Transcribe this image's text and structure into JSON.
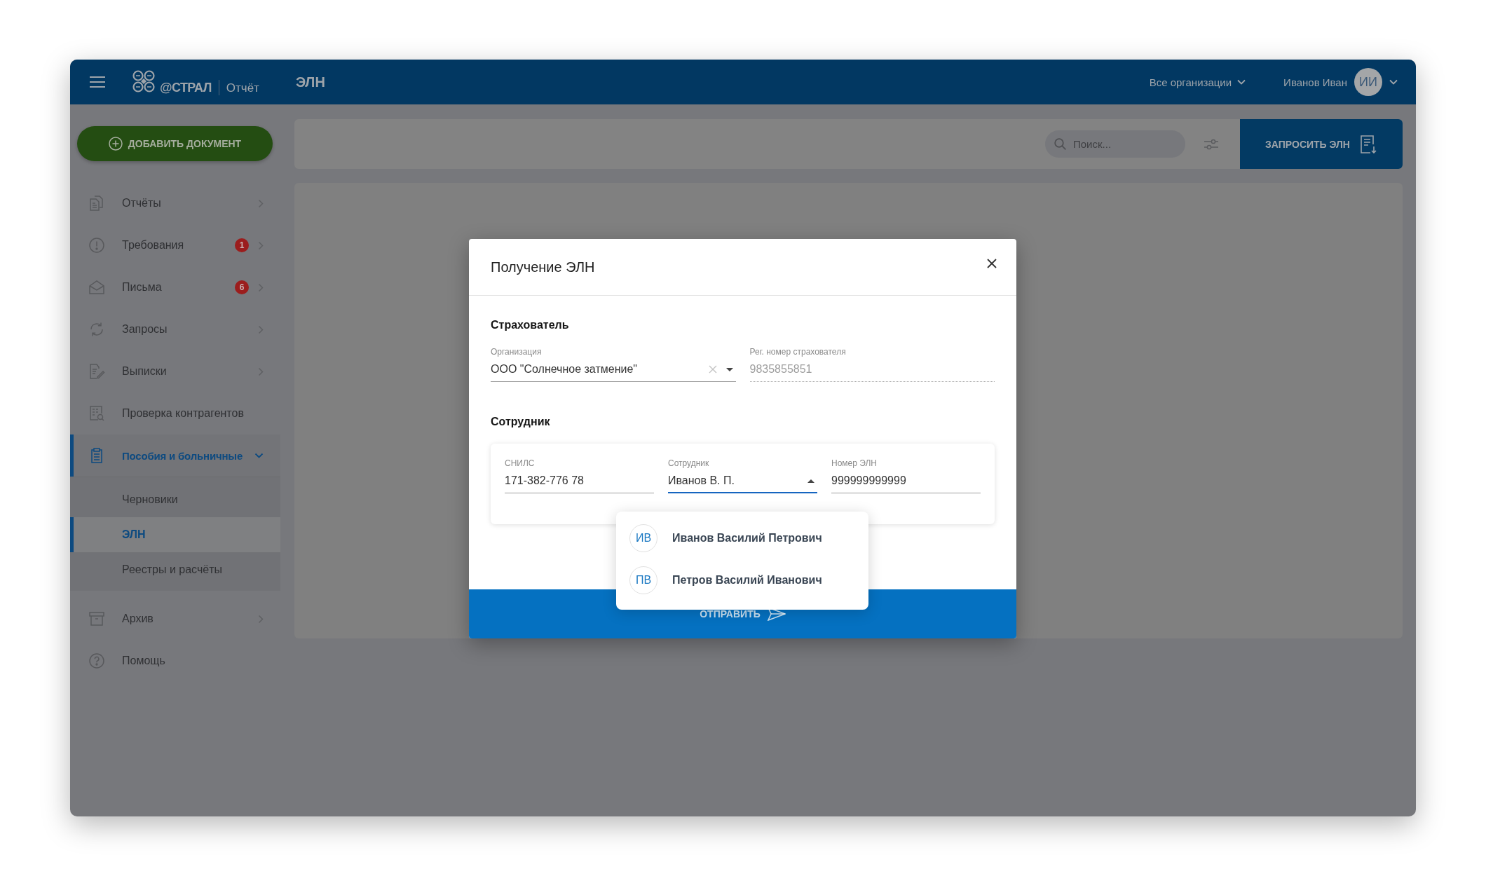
{
  "header": {
    "logo": "@СТРАЛ",
    "product": "Отчёт",
    "title": "ЭЛН",
    "organization_selector": "Все организации",
    "user": {
      "name": "Иванов Иван",
      "initials": "ИИ"
    }
  },
  "sidebar": {
    "add_button": "ДОБАВИТЬ ДОКУМЕНТ",
    "items": [
      {
        "label": "Отчёты",
        "kind": "group",
        "expanded": false,
        "selected": false
      },
      {
        "label": "Требования",
        "kind": "group",
        "badge": "1",
        "expanded": false,
        "selected": false
      },
      {
        "label": "Письма",
        "kind": "group",
        "badge": "6",
        "expanded": false,
        "selected": false
      },
      {
        "label": "Запросы",
        "kind": "group",
        "expanded": false,
        "selected": false
      },
      {
        "label": "Выписки",
        "kind": "group",
        "expanded": false,
        "selected": false
      },
      {
        "label": "Проверка контрагентов",
        "kind": "link",
        "selected": false
      },
      {
        "label": "Пособия и больничные",
        "kind": "group",
        "expanded": true,
        "selected": true,
        "children": [
          {
            "label": "Черновики",
            "selected": false
          },
          {
            "label": "ЭЛН",
            "selected": true
          },
          {
            "label": "Реестры и расчёты",
            "selected": false
          }
        ]
      },
      {
        "label": "Архив",
        "kind": "group",
        "expanded": false,
        "selected": false
      },
      {
        "label": "Помощь",
        "kind": "link",
        "selected": false
      }
    ]
  },
  "toolbar": {
    "search": {
      "placeholder": "Поиск..."
    },
    "request_button": "ЗАПРОСИТЬ ЭЛН"
  },
  "dialog": {
    "title": "Получение ЭЛН",
    "sections": [
      {
        "heading": "Страхователь",
        "kind": "plain",
        "fields": [
          {
            "kind": "select",
            "label": "Организация",
            "value": "ООО \"Солнечное затмение\""
          },
          {
            "kind": "readonly",
            "label": "Рег. номер страхователя",
            "value": "9835855851"
          }
        ]
      },
      {
        "heading": "Сотрудник",
        "kind": "card",
        "fields": [
          {
            "kind": "text",
            "label": "СНИЛС",
            "value": "171-382-776 78"
          },
          {
            "kind": "combo",
            "label": "Сотрудник",
            "value": "Иванов В. П.",
            "expanded": true,
            "options": [
              {
                "initials": "ИВ",
                "name": "Иванов Василий Петрович",
                "selected": false
              },
              {
                "initials": "ПВ",
                "name": "Петров Василий Иванович",
                "selected": false
              }
            ]
          },
          {
            "kind": "text",
            "label": "Номер ЭЛН",
            "value": "999999999999"
          }
        ]
      }
    ],
    "submit_button": "ОТПРАВИТЬ"
  }
}
